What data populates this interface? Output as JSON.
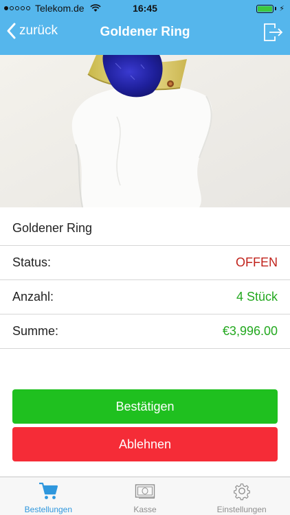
{
  "status_bar": {
    "carrier": "Telekom.de",
    "time": "16:45",
    "signal_bars_filled": 1,
    "signal_bars_total": 5,
    "battery_level": 1.0
  },
  "nav": {
    "back_label": "zurück",
    "title": "Goldener Ring",
    "right_icon": "logout-icon"
  },
  "product": {
    "name": "Goldener Ring",
    "photo_icon": "ring-photo"
  },
  "details": {
    "status_label": "Status:",
    "status_value": "OFFEN",
    "quantity_label": "Anzahl:",
    "quantity_value": "4 Stück",
    "sum_label": "Summe:",
    "sum_value": "€3,996.00"
  },
  "actions": {
    "confirm_label": "Bestätigen",
    "reject_label": "Ablehnen"
  },
  "tabs": [
    {
      "label": "Bestellungen",
      "icon": "cart-icon",
      "active": true
    },
    {
      "label": "Kasse",
      "icon": "cash-icon",
      "active": false
    },
    {
      "label": "Einstellungen",
      "icon": "gear-icon",
      "active": false
    }
  ],
  "colors": {
    "nav_bar": "#55b6ec",
    "status_open": "#c0221b",
    "positive": "#22a81e",
    "confirm_button": "#1fc01f",
    "reject_button": "#f52c37",
    "tab_active": "#2f97dd",
    "tab_inactive": "#8e8e8e"
  }
}
